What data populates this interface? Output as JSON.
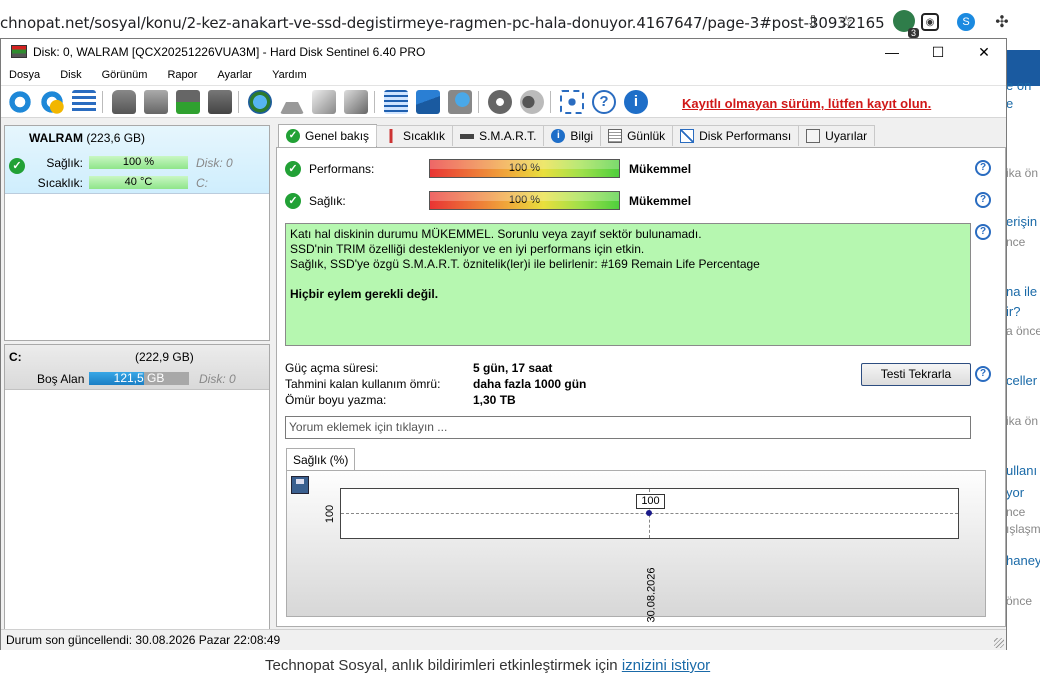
{
  "browser": {
    "url": "chnopat.net/sosyal/konu/2-kez-anakart-ve-ssd-degistirmeye-ragmen-pc-hala-donuyor.4167647/page-3#post-30932165",
    "ext_badge_count": "3"
  },
  "webpage": {
    "bottom_text": "Technopat Sosyal, anlık bildirimleri etkinleştirmek için ",
    "bottom_link": "iznizini istiyor",
    "right_snippets": [
      "e on",
      "e",
      "ika ön",
      "erişin",
      "nce",
      "na ile",
      "ir?",
      "a önce",
      "celler",
      "ika ön",
      "ullanı",
      "yor",
      "nce",
      "ışlaşm",
      "haney",
      "önce"
    ]
  },
  "window": {
    "title": "Disk: 0, WALRAM [QCX20251226VUA3M]  -  Hard Disk Sentinel 6.40 PRO",
    "minimize": "—",
    "maximize": "☐",
    "close": "✕"
  },
  "menu": [
    "Dosya",
    "Disk",
    "Görünüm",
    "Rapor",
    "Ayarlar",
    "Yardım"
  ],
  "toolbar": {
    "unregistered_notice": "Kayıtlı olmayan sürüm, lütfen kayıt olun."
  },
  "disk": {
    "name": "WALRAM",
    "size": "(223,6 GB)",
    "health_label": "Sağlık:",
    "health_value": "100 %",
    "health_disk": "Disk: 0",
    "temp_label": "Sıcaklık:",
    "temp_value": "40 °C",
    "temp_drive": "C:"
  },
  "volume": {
    "letter": "C:",
    "size": "(222,9 GB)",
    "free_label": "Boş Alan",
    "free_value": "121,5 GB",
    "free_fraction": 0.545,
    "free_disk": "Disk: 0"
  },
  "tabs": [
    "Genel bakış",
    "Sıcaklık",
    "S.M.A.R.T.",
    "Bilgi",
    "Günlük",
    "Disk Performansı",
    "Uyarılar"
  ],
  "overview": {
    "performance_label": "Performans:",
    "performance_value": "100 %",
    "performance_status": "Mükemmel",
    "health_label": "Sağlık:",
    "health_value": "100 %",
    "health_status": "Mükemmel",
    "message_lines": [
      "Katı hal diskinin durumu MÜKEMMEL. Sorunlu veya zayıf sektör bulunamadı.",
      "SSD'nin TRIM özelliği destekleniyor ve en iyi performans için etkin.",
      "Sağlık, SSD'ye özgü S.M.A.R.T. öznitelik(ler)i ile belirlenir:  #169 Remain Life Percentage"
    ],
    "message_bold": "Hiçbir eylem gerekli değil.",
    "power_on_label": "Güç açma süresi:",
    "power_on_value": "5 gün, 17 saat",
    "remaining_label": "Tahmini kalan kullanım ömrü:",
    "remaining_value": "daha fazla 1000 gün",
    "lifetime_label": "Ömür boyu yazma:",
    "lifetime_value": "1,30 TB",
    "retest_button": "Testi Tekrarla",
    "comment_placeholder": "Yorum eklemek için tıklayın ...",
    "graph_tab": "Sağlık (%)"
  },
  "chart_data": {
    "type": "line",
    "x": [
      "30.08.2026"
    ],
    "series": [
      {
        "values": [
          100
        ]
      }
    ],
    "y_tick_labels": [
      "100"
    ],
    "data_labels": [
      "100"
    ]
  },
  "statusbar": {
    "text": "Durum son güncellendi: 30.08.2026 Pazar 22:08:49"
  }
}
